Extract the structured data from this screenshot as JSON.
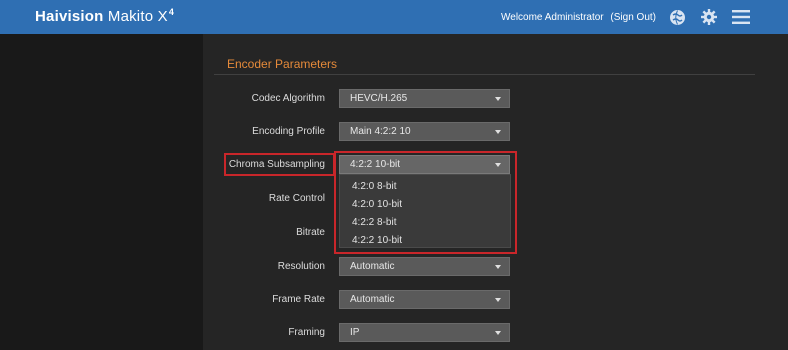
{
  "header": {
    "brand_name": "Haivision",
    "product_name": "Makito X",
    "product_suffix": "4",
    "welcome_text": "Welcome Administrator",
    "sign_out_label": "(Sign Out)",
    "icons": [
      "globe-icon",
      "gear-icon",
      "hamburger-menu-icon"
    ],
    "accent_color": "#2f6fb3"
  },
  "section": {
    "title": "Encoder Parameters",
    "title_color": "#e58a3a"
  },
  "fields": {
    "codec_algorithm": {
      "label": "Codec Algorithm",
      "value": "HEVC/H.265"
    },
    "encoding_profile": {
      "label": "Encoding Profile",
      "value": "Main 4:2:2 10"
    },
    "chroma_subsampling": {
      "label": "Chroma Subsampling",
      "value": "4:2:2 10-bit"
    },
    "rate_control": {
      "label": "Rate Control"
    },
    "bitrate": {
      "label": "Bitrate"
    },
    "resolution": {
      "label": "Resolution",
      "value": "Automatic"
    },
    "frame_rate": {
      "label": "Frame Rate",
      "value": "Automatic"
    },
    "framing": {
      "label": "Framing",
      "value": "IP"
    }
  },
  "chroma_dropdown": {
    "options": [
      "4:2:0 8-bit",
      "4:2:0 10-bit",
      "4:2:2 8-bit",
      "4:2:2 10-bit"
    ],
    "highlight_color": "#c9262a"
  }
}
